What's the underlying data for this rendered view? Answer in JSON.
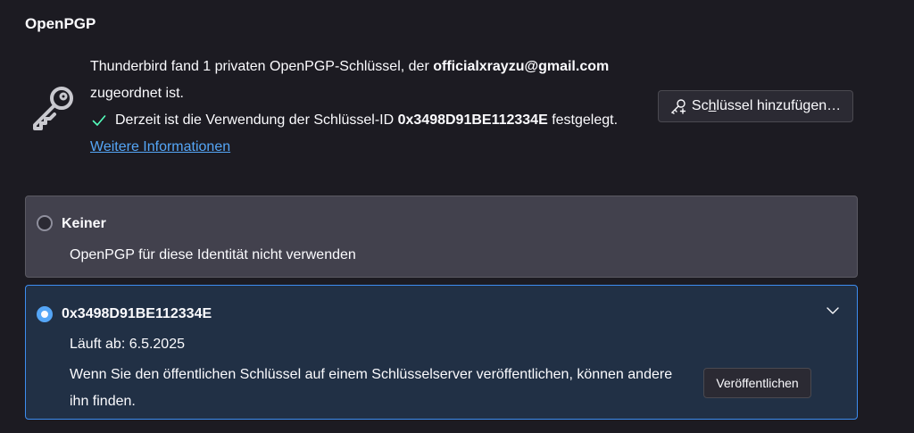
{
  "section": {
    "title": "OpenPGP"
  },
  "icons": {
    "key": "key-icon",
    "check": "checkmark-icon",
    "add_key": "key-plus-icon",
    "chevron": "chevron-down-icon"
  },
  "info": {
    "line_prefix": "Thunderbird fand 1 privaten OpenPGP-Schlüssel, der ",
    "email": "officialxrayzu@gmail.com",
    "line_suffix": "zugeordnet ist.",
    "status_prefix": "Derzeit ist die Verwendung der Schlüssel-ID ",
    "status_key_id": "0x3498D91BE112334E",
    "status_suffix": " festgelegt.",
    "more_info_link": "Weitere Informationen"
  },
  "add_key_button": {
    "label_before": "Sc",
    "label_accesskey": "h",
    "label_after": "lüssel hinzufügen…"
  },
  "options": {
    "none": {
      "title": "Keiner",
      "description": "OpenPGP für diese Identität nicht verwenden",
      "selected": false
    },
    "key": {
      "title": "0x3498D91BE112334E",
      "selected": true,
      "expires": "Läuft ab: 6.5.2025",
      "publish_text": "Wenn Sie den öffentlichen Schlüssel auf einem Schlüsselserver veröffentlichen, können andere ihn finden.",
      "publish_button": "Veröffentlichen"
    }
  },
  "colors": {
    "background": "#1c1b22",
    "link": "#55a6f7",
    "accent": "#3d8df0",
    "check": "#54ffbd"
  }
}
